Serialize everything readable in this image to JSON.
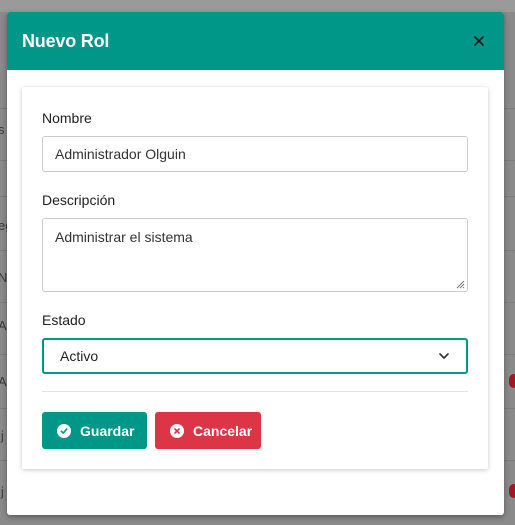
{
  "background": {
    "row_fragments": [
      "s",
      "eg",
      "N",
      "Ad",
      "Ar",
      "ij",
      "ij"
    ]
  },
  "modal": {
    "title": "Nuevo Rol",
    "close_icon": "close-icon",
    "header_color": "#009688"
  },
  "form": {
    "name_label": "Nombre",
    "name_value": "Administrador Olguin",
    "description_label": "Descripción",
    "description_value": "Administrar el sistema",
    "status_label": "Estado",
    "status_value": "Activo"
  },
  "actions": {
    "save_label": "Guardar",
    "save_icon": "check-circle-icon",
    "save_color": "#009688",
    "cancel_label": "Cancelar",
    "cancel_icon": "x-circle-icon",
    "cancel_color": "#dc3545"
  }
}
